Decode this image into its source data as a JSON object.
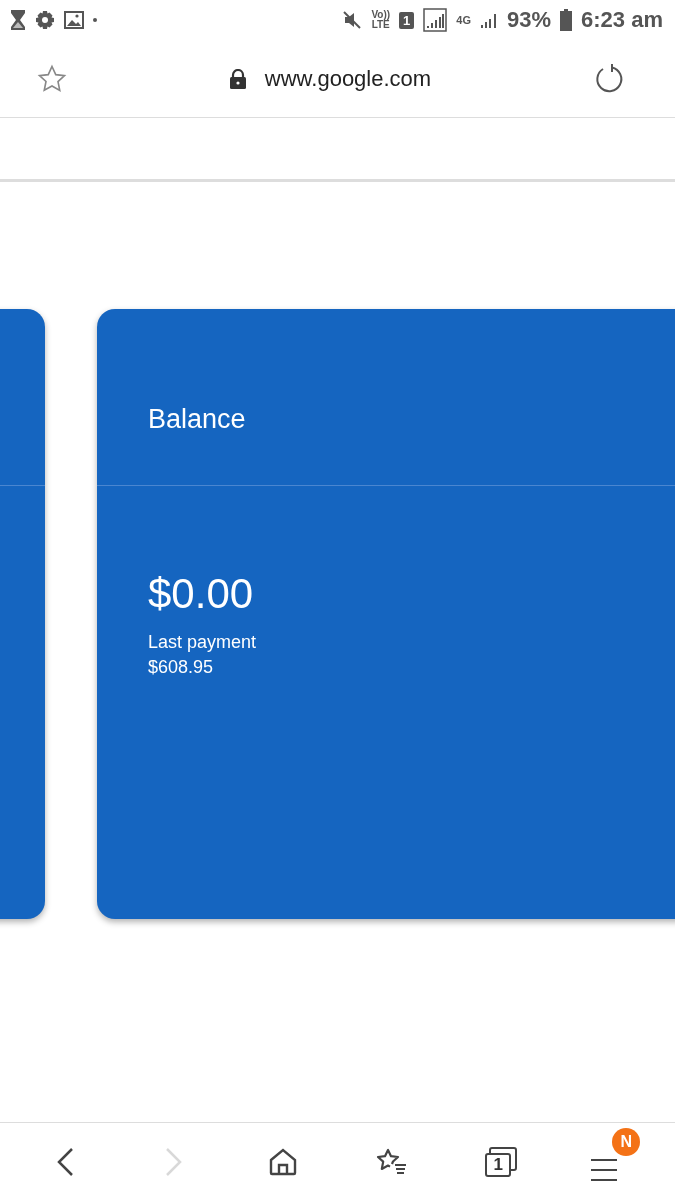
{
  "status_bar": {
    "volte_top": "Vo))",
    "volte_bottom": "LTE",
    "sim": "1",
    "data_type": "4G",
    "battery": "93%",
    "time": "6:23 am"
  },
  "address_bar": {
    "url": "www.google.com"
  },
  "card": {
    "title": "Balance",
    "amount": "$0.00",
    "caption": "Last payment",
    "last_amount": "$608.95"
  },
  "bottom_nav": [
    {
      "kind": "back",
      "disabled": false
    },
    {
      "kind": "forward",
      "disabled": true
    },
    {
      "kind": "home"
    },
    {
      "kind": "bookmarks"
    },
    {
      "kind": "tabs",
      "count": "1"
    },
    {
      "kind": "menu",
      "badge": "N"
    }
  ]
}
